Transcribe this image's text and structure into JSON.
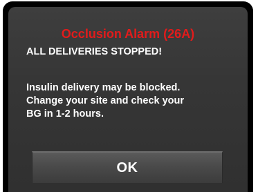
{
  "alert": {
    "title": "Occlusion Alarm (26A)",
    "subtitle": "ALL DELIVERIES STOPPED!",
    "message_lines": [
      "Insulin delivery may be blocked.",
      "Change your site and check your",
      "BG in 1-2 hours."
    ],
    "ok_label": "OK"
  },
  "colors": {
    "title": "#e21b1b",
    "text": "#ffffff",
    "panel": "#363636",
    "bezel": "#000000"
  }
}
